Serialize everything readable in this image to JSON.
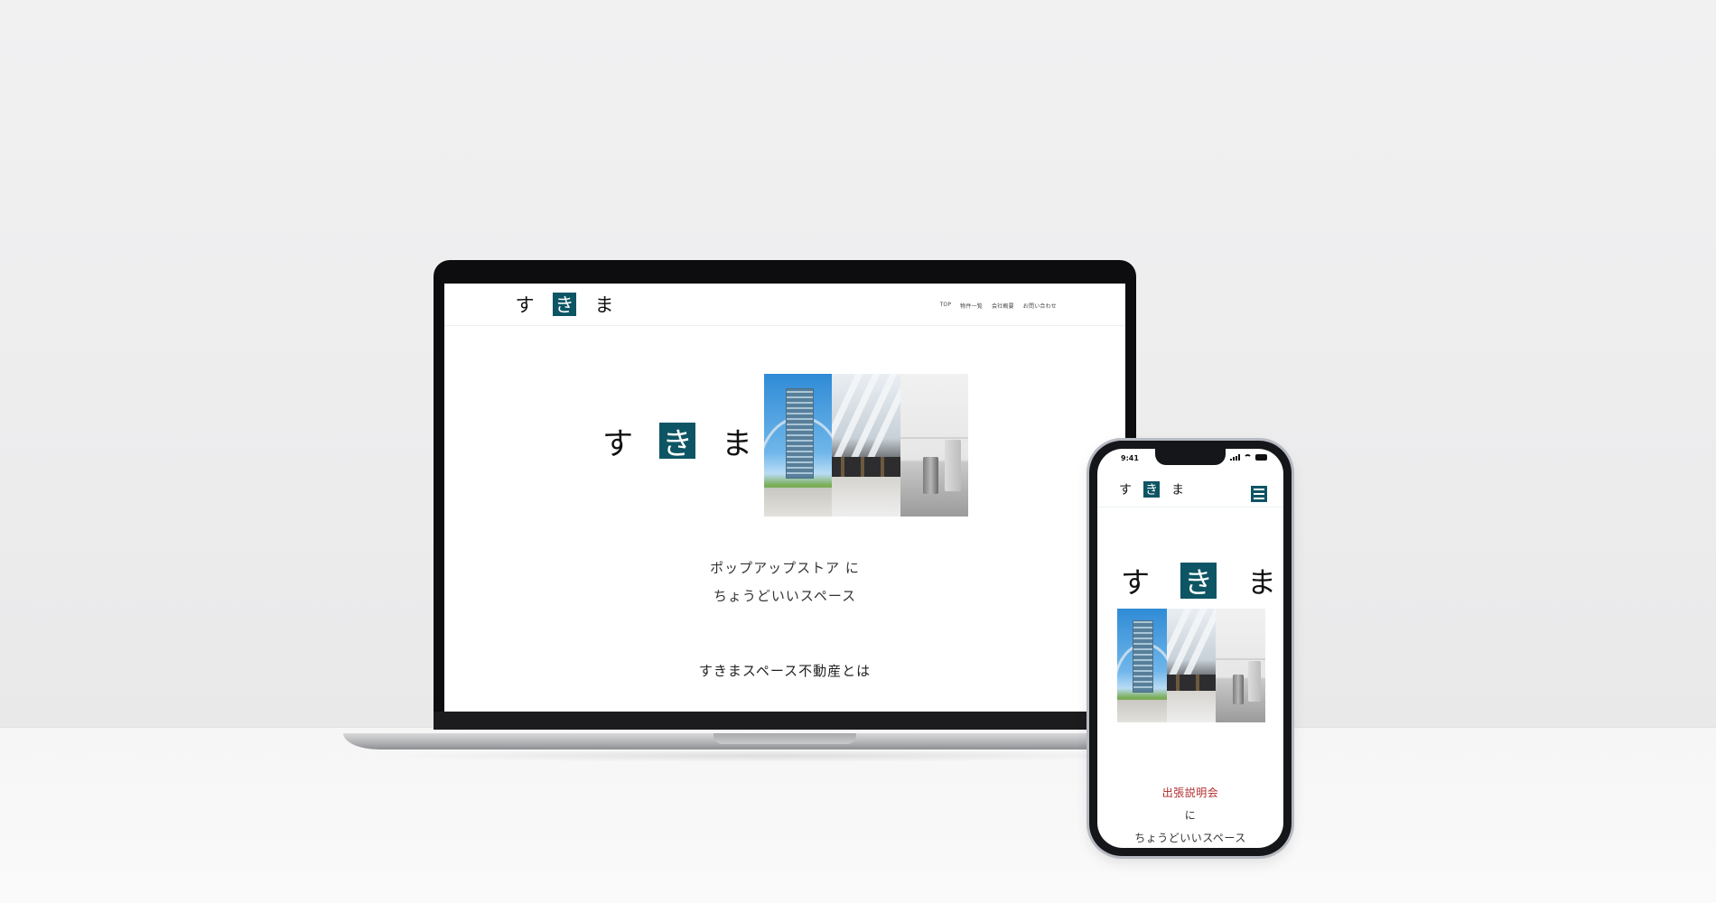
{
  "laptop_site": {
    "logo": [
      "す",
      "き",
      "ま"
    ],
    "nav": [
      "TOP",
      "物件一覧",
      "会社概要",
      "お問い合わせ"
    ],
    "hero_logo": [
      "す",
      "き",
      "ま"
    ],
    "tagline": [
      "ポップアップストア に",
      "ちょうどいいスペース"
    ],
    "section_title": "すきまスペース不動産とは"
  },
  "phone_site": {
    "status_time": "9:41",
    "logo": [
      "す",
      "き",
      "ま"
    ],
    "menu_icon": "hamburger-menu-icon",
    "hero_logo": [
      "す",
      "き",
      "ま"
    ],
    "tag_highlight": "出張説明会",
    "tag_particle": "に",
    "tag_rest": "ちょうどいいスペース"
  },
  "colors": {
    "accent": "#0d5564",
    "highlight_text": "#b22a2a",
    "background": "#efeff0"
  }
}
